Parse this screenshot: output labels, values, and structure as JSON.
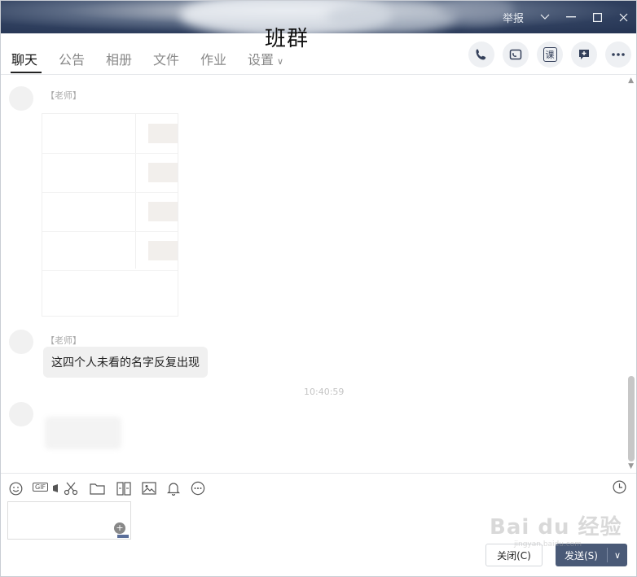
{
  "window": {
    "title": "班群",
    "report_label": "举报"
  },
  "tabs": [
    {
      "label": "聊天"
    },
    {
      "label": "公告"
    },
    {
      "label": "相册"
    },
    {
      "label": "文件"
    },
    {
      "label": "作业"
    },
    {
      "label": "设置"
    }
  ],
  "header_actions": {
    "course_label": "课"
  },
  "messages": {
    "sender_1": "【老师】",
    "sender_2": "【老师】",
    "text_message": "这四个人未看的名字反复出现",
    "timestamp": "10:40:59"
  },
  "toolbar": {
    "gif_label": "GIF"
  },
  "buttons": {
    "close_label": "关闭(C)",
    "send_label": "发送(S)"
  },
  "watermark": {
    "brand": "Bai du 经验",
    "url": "jingyan.baidu.com"
  }
}
